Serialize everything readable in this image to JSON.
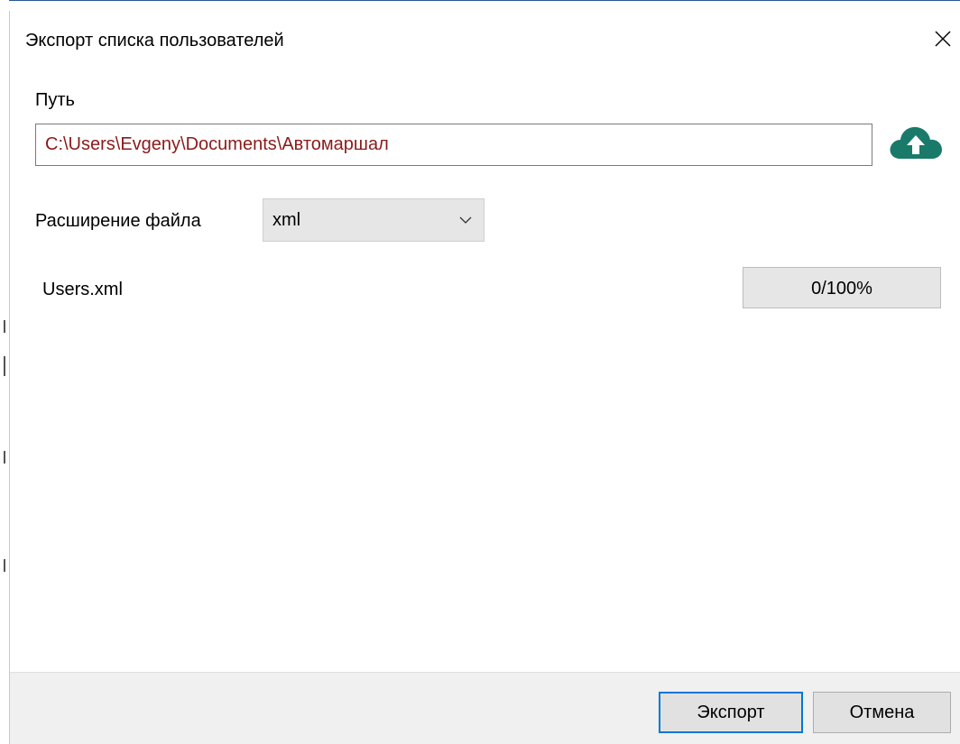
{
  "window": {
    "title": "Экспорт списка пользователей"
  },
  "icons": {
    "close": "close-icon",
    "upload": "cloud-upload-icon",
    "dropdown": "chevron-down-icon"
  },
  "colors": {
    "path_text": "#8b1a1a",
    "upload_icon": "#1a7a6a",
    "primary_button_border": "#0078d7",
    "progress_fill": "#06b025"
  },
  "path": {
    "label": "Путь",
    "value": "C:\\Users\\Evgeny\\Documents\\Автомаршал"
  },
  "extension": {
    "label": "Расширение файла",
    "selected": "xml"
  },
  "file": {
    "name": "Users.xml",
    "progress_text": "0/100%",
    "progress": 0
  },
  "footer": {
    "export_label": "Экспорт",
    "cancel_label": "Отмена"
  }
}
